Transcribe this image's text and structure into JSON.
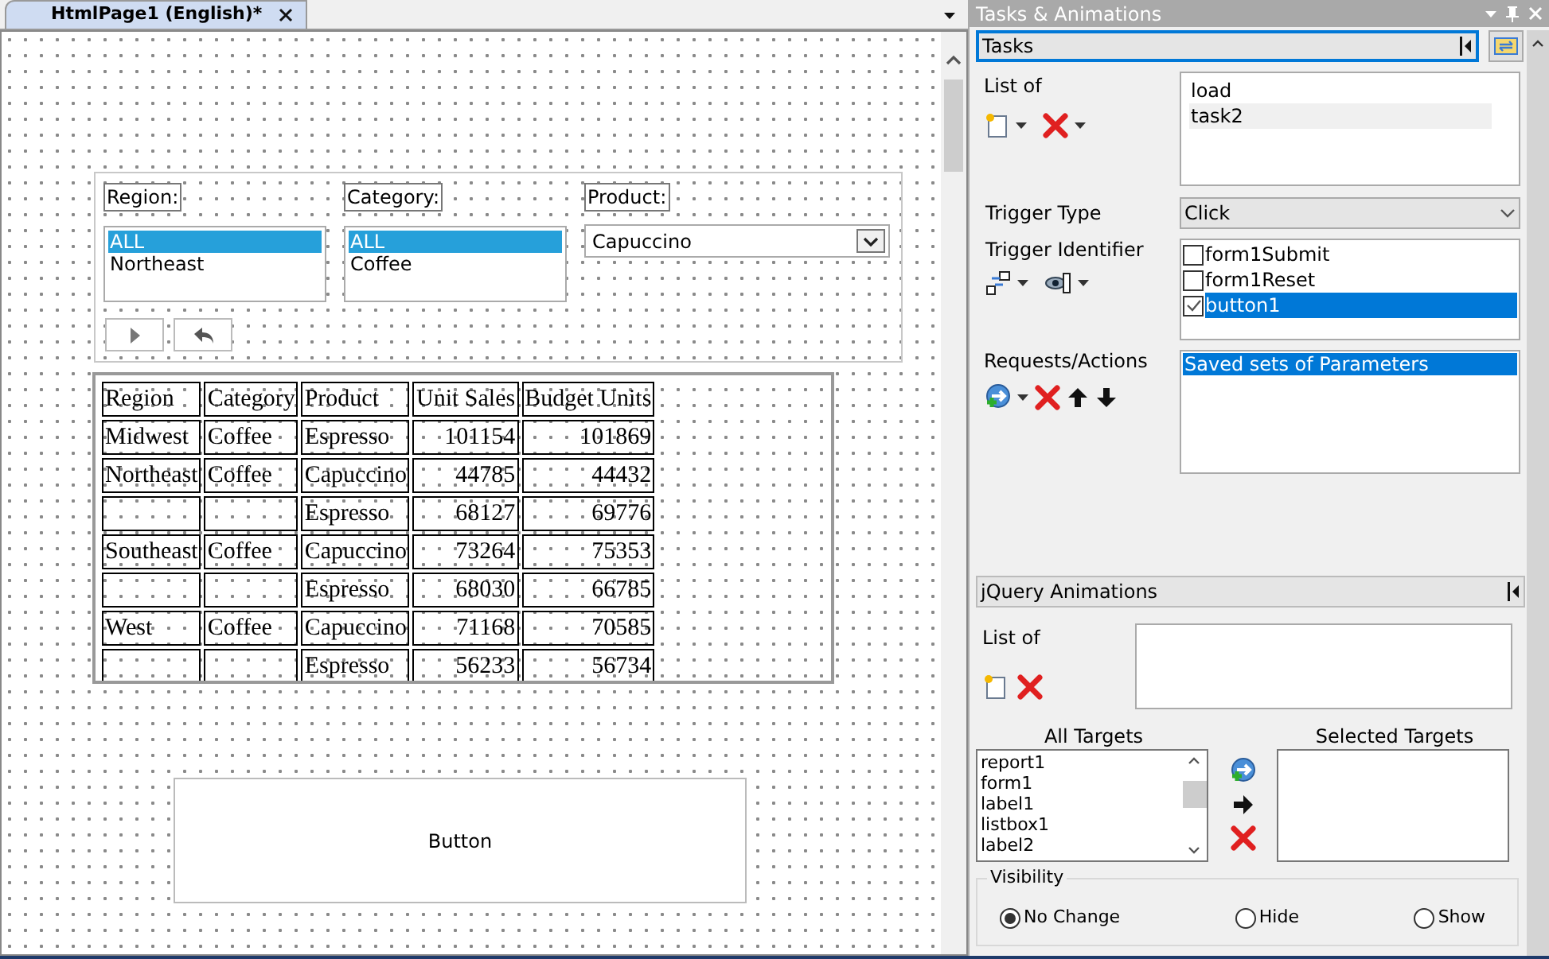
{
  "document_tab": {
    "title": "HtmlPage1 (English)*",
    "selected": true
  },
  "filters": [
    {
      "kind": "listbox",
      "label": "Region:",
      "items": [
        {
          "text": "ALL",
          "selected": true
        },
        {
          "text": "Northeast",
          "selected": false
        }
      ]
    },
    {
      "kind": "listbox",
      "label": "Category:",
      "items": [
        {
          "text": "ALL",
          "selected": true
        },
        {
          "text": "Coffee",
          "selected": false
        }
      ]
    },
    {
      "kind": "dropdown",
      "label": "Product:",
      "value": "Capuccino"
    }
  ],
  "table": {
    "columns": [
      "Region",
      "Category",
      "Product",
      "Unit Sales",
      "Budget Units"
    ],
    "rows": [
      [
        "Midwest",
        "Coffee",
        "Espresso",
        "101154",
        "101869"
      ],
      [
        "Northeast",
        "Coffee",
        "Capuccino",
        "44785",
        "44432"
      ],
      [
        "",
        "",
        "Espresso",
        "68127",
        "69776"
      ],
      [
        "Southeast",
        "Coffee",
        "Capuccino",
        "73264",
        "75353"
      ],
      [
        "",
        "",
        "Espresso",
        "68030",
        "66785"
      ],
      [
        "West",
        "Coffee",
        "Capuccino",
        "71168",
        "70585"
      ],
      [
        "",
        "",
        "Espresso",
        "56233",
        "56734"
      ]
    ]
  },
  "button": {
    "label": "Button"
  },
  "panel": {
    "title": "Tasks & Animations",
    "tasks": {
      "header": "Tasks",
      "list_label": "List of",
      "items": [
        {
          "text": "load",
          "selected": false
        },
        {
          "text": "task2",
          "selected": true
        }
      ],
      "trigger_type_label": "Trigger Type",
      "trigger_type": "Click",
      "trigger_identifier_label": "Trigger Identifier",
      "trigger_identifiers": [
        {
          "text": "form1Submit",
          "checked": false,
          "selected": false
        },
        {
          "text": "form1Reset",
          "checked": false,
          "selected": false
        },
        {
          "text": "button1",
          "checked": true,
          "selected": true
        }
      ],
      "requests_label": "Requests/Actions",
      "requests": [
        {
          "text": "Saved sets of Parameters",
          "selected": true
        }
      ]
    },
    "animations": {
      "header": "jQuery Animations",
      "list_label": "List of",
      "all_targets_label": "All Targets",
      "selected_targets_label": "Selected Targets",
      "all_targets": [
        "report1",
        "form1",
        "label1",
        "listbox1",
        "label2"
      ],
      "visibility": {
        "label": "Visibility",
        "options": [
          {
            "label": "No Change",
            "selected": true
          },
          {
            "label": "Hide",
            "selected": false
          },
          {
            "label": "Show",
            "selected": false
          }
        ]
      }
    }
  }
}
